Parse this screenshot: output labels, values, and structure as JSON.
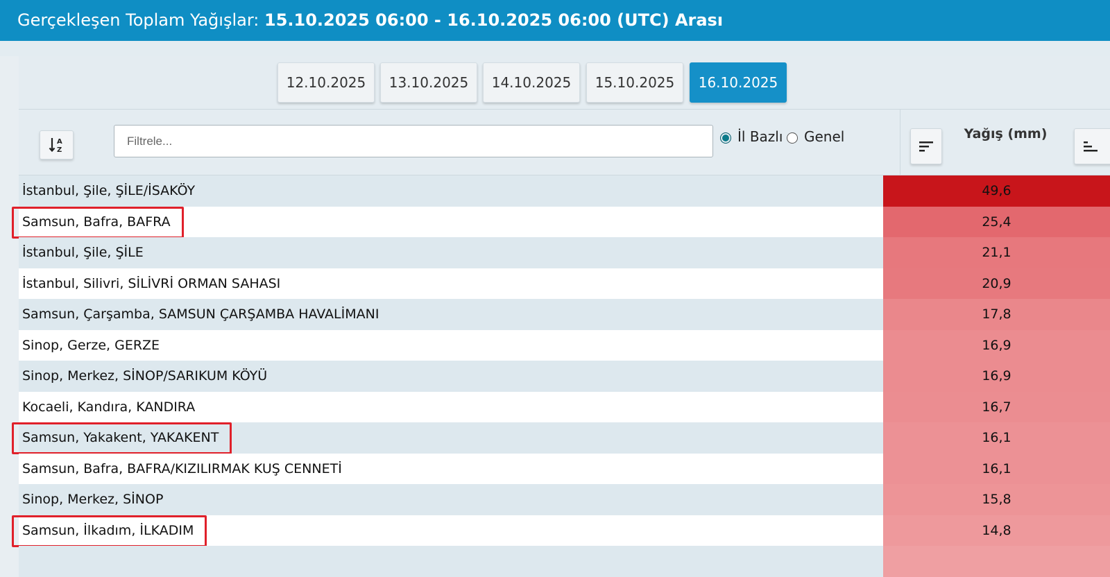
{
  "header": {
    "label": "Gerçekleşen Toplam Yağışlar: ",
    "range": "15.10.2025 06:00 - 16.10.2025 06:00 (UTC) Arası"
  },
  "tabs": [
    {
      "label": "12.10.2025",
      "active": false
    },
    {
      "label": "13.10.2025",
      "active": false
    },
    {
      "label": "14.10.2025",
      "active": false
    },
    {
      "label": "15.10.2025",
      "active": false
    },
    {
      "label": "16.10.2025",
      "active": true
    }
  ],
  "toolbar": {
    "sort_icon": "sort-alpha-icon",
    "filter_placeholder": "Filtrele...",
    "radio_il": "İl Bazlı",
    "radio_genel": "Genel",
    "selected": "il"
  },
  "column": {
    "title": "Yağış (mm)",
    "sort_desc_icon": "sort-desc-icon",
    "sort_asc_icon": "sort-asc-icon"
  },
  "rows": [
    {
      "name": "İstanbul, Şile, ŞİLE/İSAKÖY",
      "value": "49,6",
      "color": "#c8151b",
      "highlighted": false
    },
    {
      "name": "Samsun, Bafra, BAFRA",
      "value": "25,4",
      "color": "#e3686e",
      "highlighted": true
    },
    {
      "name": "İstanbul, Şile, ŞİLE",
      "value": "21,1",
      "color": "#e7787d",
      "highlighted": false
    },
    {
      "name": "İstanbul, Silivri, SİLİVRİ ORMAN SAHASI",
      "value": "20,9",
      "color": "#e7797e",
      "highlighted": false
    },
    {
      "name": "Samsun, Çarşamba, SAMSUN ÇARŞAMBA HAVALİMANI",
      "value": "17,8",
      "color": "#ea878b",
      "highlighted": false
    },
    {
      "name": "Sinop, Gerze, GERZE",
      "value": "16,9",
      "color": "#eb8c90",
      "highlighted": false
    },
    {
      "name": "Sinop, Merkez, SİNOP/SARIKUM KÖYÜ",
      "value": "16,9",
      "color": "#eb8c90",
      "highlighted": false
    },
    {
      "name": "Kocaeli, Kandıra, KANDIRA",
      "value": "16,7",
      "color": "#eb8d91",
      "highlighted": false
    },
    {
      "name": "Samsun, Yakakent, YAKAKENT",
      "value": "16,1",
      "color": "#ec9195",
      "highlighted": true
    },
    {
      "name": "Samsun, Bafra, BAFRA/KIZILIRMAK KUŞ CENNETİ",
      "value": "16,1",
      "color": "#ec9195",
      "highlighted": false
    },
    {
      "name": "Sinop, Merkez, SİNOP",
      "value": "15,8",
      "color": "#ed9497",
      "highlighted": false
    },
    {
      "name": "Samsun, İlkadım, İLKADIM",
      "value": "14,8",
      "color": "#ee999c",
      "highlighted": true
    },
    {
      "name": "",
      "value": "",
      "color": "#ef9fa2",
      "highlighted": false
    }
  ]
}
